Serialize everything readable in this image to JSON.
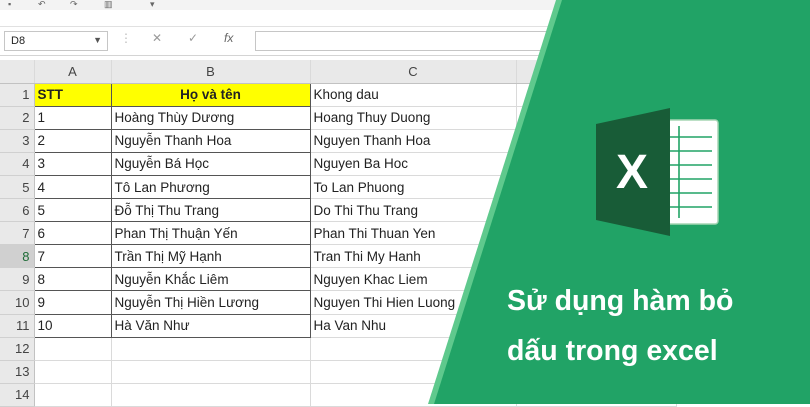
{
  "formula_bar": {
    "name_box": "D8",
    "fx_symbol": "fx",
    "cancel_symbol": "✕",
    "enter_symbol": "✓"
  },
  "columns": [
    "A",
    "B",
    "C"
  ],
  "rows": [
    {
      "num": "1",
      "a": "STT",
      "b": "Họ và tên",
      "c": "Khong dau"
    },
    {
      "num": "2",
      "a": "1",
      "b": "Hoàng Thùy Dương",
      "c": "Hoang Thuy Duong"
    },
    {
      "num": "3",
      "a": "2",
      "b": "Nguyễn Thanh Hoa",
      "c": "Nguyen Thanh Hoa"
    },
    {
      "num": "4",
      "a": "3",
      "b": "Nguyễn Bá Học",
      "c": "Nguyen Ba Hoc"
    },
    {
      "num": "5",
      "a": "4",
      "b": "Tô Lan Phương",
      "c": "To Lan Phuong"
    },
    {
      "num": "6",
      "a": "5",
      "b": "Đỗ Thị Thu Trang",
      "c": "Do Thi Thu Trang"
    },
    {
      "num": "7",
      "a": "6",
      "b": "Phan Thị Thuận Yến",
      "c": "Phan Thi Thuan Yen"
    },
    {
      "num": "8",
      "a": "7",
      "b": "Trần Thị Mỹ Hạnh",
      "c": "Tran Thi My Hanh"
    },
    {
      "num": "9",
      "a": "8",
      "b": "Nguyễn Khắc Liêm",
      "c": "Nguyen Khac Liem"
    },
    {
      "num": "10",
      "a": "9",
      "b": "Nguyễn Thị Hiền Lương",
      "c": "Nguyen Thi Hien Luong"
    },
    {
      "num": "11",
      "a": "10",
      "b": "Hà Văn Như",
      "c": "Ha Van Nhu"
    },
    {
      "num": "12",
      "a": "",
      "b": "",
      "c": ""
    },
    {
      "num": "13",
      "a": "",
      "b": "",
      "c": ""
    },
    {
      "num": "14",
      "a": "",
      "b": "",
      "c": ""
    }
  ],
  "banner": {
    "line1": "Sử dụng hàm bỏ",
    "line2": "dấu trong excel",
    "logo_letter": "X"
  },
  "colors": {
    "excel_green": "#21a366",
    "logo_dark": "#185c37",
    "header_fill": "#ffff00"
  }
}
